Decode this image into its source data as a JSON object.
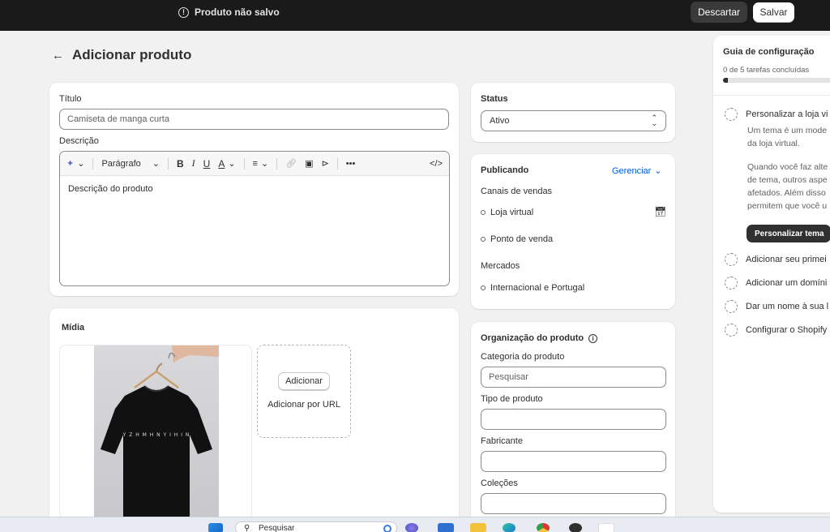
{
  "topbar": {
    "status": "Produto não salvo",
    "discard_label": "Descartar",
    "save_label": "Salvar"
  },
  "page": {
    "title": "Adicionar produto"
  },
  "product": {
    "title_label": "Título",
    "title_value": "Camiseta de manga curta",
    "description_label": "Descrição",
    "toolbar": {
      "paragraph": "Parágrafo"
    },
    "description_placeholder": "Descrição do produto"
  },
  "media": {
    "title": "Mídia",
    "tshirt_print": "Y Z H M H N   Y I H I N",
    "add_button": "Adicionar",
    "add_url": "Adicionar por URL"
  },
  "status": {
    "title": "Status",
    "value": "Ativo"
  },
  "publishing": {
    "title": "Publicando",
    "manage": "Gerenciar",
    "channels_title": "Canais de vendas",
    "channels": [
      "Loja virtual",
      "Ponto de venda"
    ],
    "markets_title": "Mercados",
    "markets": [
      "Internacional e Portugal"
    ]
  },
  "organization": {
    "title": "Organização do produto",
    "category_label": "Categoria do produto",
    "category_placeholder": "Pesquisar",
    "type_label": "Tipo de produto",
    "vendor_label": "Fabricante",
    "collections_label": "Coleções"
  },
  "guide": {
    "title": "Guia de configuração",
    "count": "0 de 5 tarefas concluídas",
    "progress": 0.04,
    "tasks": [
      "Personalizar a loja vi",
      "Adicionar seu primei",
      "Adicionar um domíni",
      "Dar um nome à sua l",
      "Configurar o Shopify"
    ],
    "desc_lines": [
      "Um tema é um mode",
      "da loja virtual.",
      "Quando você faz alte",
      "de tema, outros aspe",
      "afetados. Além disso",
      "permitem que você u"
    ],
    "theme_button": "Personalizar tema"
  },
  "taskbar": {
    "search": "Pesquisar"
  }
}
